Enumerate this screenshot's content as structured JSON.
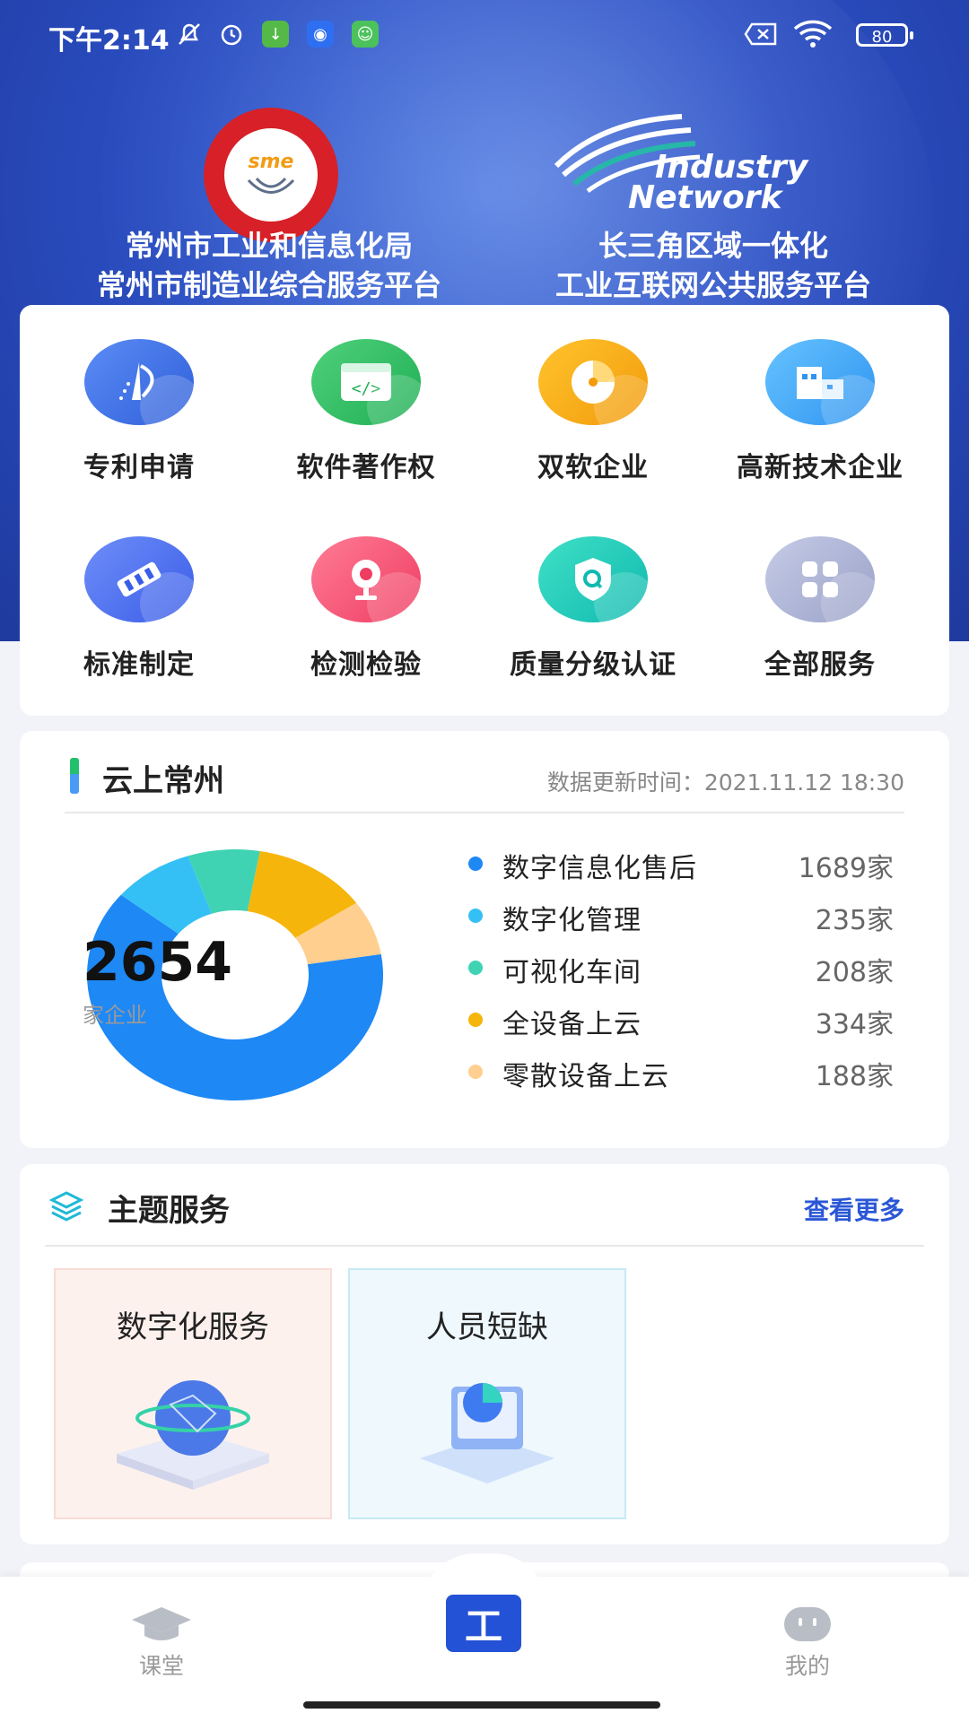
{
  "status_bar": {
    "time": "下午2:14",
    "battery": "80",
    "icons": [
      "mute-icon",
      "alarm-icon",
      "download-app-icon",
      "radio-app-icon",
      "chat-app-icon",
      "sim-off-icon",
      "wifi-icon",
      "battery-icon"
    ]
  },
  "header": {
    "left_org_line1": "常州市工业和信息化局",
    "left_org_line2": "常州市制造业综合服务平台",
    "right_org_line1": "长三角区域一体化",
    "right_org_line2": "工业互联网公共服务平台",
    "left_logo_text": "sme",
    "right_logo_line1": "Industry",
    "right_logo_line2": "Network"
  },
  "services": [
    {
      "label": "专利申请",
      "icon": "patent-icon",
      "color1": "#5b8cf5",
      "color2": "#2f5fd9"
    },
    {
      "label": "软件著作权",
      "icon": "code-window-icon",
      "color1": "#4fd17b",
      "color2": "#1fae55"
    },
    {
      "label": "双软企业",
      "icon": "pie-disc-icon",
      "color1": "#ffc42e",
      "color2": "#f29a0a"
    },
    {
      "label": "高新技术企业",
      "icon": "building-icon",
      "color1": "#66c3ff",
      "color2": "#2f94f0"
    },
    {
      "label": "标准制定",
      "icon": "ruler-icon",
      "color1": "#6e8ef8",
      "color2": "#3a5de8"
    },
    {
      "label": "检测检验",
      "icon": "webcam-icon",
      "color1": "#ff7c95",
      "color2": "#ef3d62"
    },
    {
      "label": "质量分级认证",
      "icon": "shield-check-icon",
      "color1": "#3fe0c5",
      "color2": "#10b9b0"
    },
    {
      "label": "全部服务",
      "icon": "grid-four-icon",
      "color1": "#c5cbe6",
      "color2": "#9aa2c8"
    }
  ],
  "cloud": {
    "title": "云上常州",
    "updated": "数据更新时间：2021.11.12 18:30",
    "total": "2654",
    "total_unit": "家企业"
  },
  "chart_data": {
    "type": "pie",
    "categories": [
      "数字信息化售后",
      "数字化管理",
      "可视化车间",
      "全设备上云",
      "零散设备上云"
    ],
    "values": [
      1689,
      235,
      208,
      334,
      188
    ],
    "value_labels": [
      "1689家",
      "235家",
      "208家",
      "334家",
      "188家"
    ],
    "colors": [
      "#1e88f5",
      "#35c0f5",
      "#3fd3b4",
      "#f6b50a",
      "#ffcf8f"
    ],
    "title": "",
    "legend": "right"
  },
  "theme": {
    "title": "主题服务",
    "more": "查看更多",
    "tiles": [
      {
        "label": "数字化服务",
        "bg": "#fdf1ee",
        "border": "#f9dcd5"
      },
      {
        "label": "人员短缺",
        "bg": "#eef8fd",
        "border": "#c7eaf5"
      }
    ]
  },
  "nav": {
    "left": "课堂",
    "center": "工",
    "right": "我的"
  }
}
